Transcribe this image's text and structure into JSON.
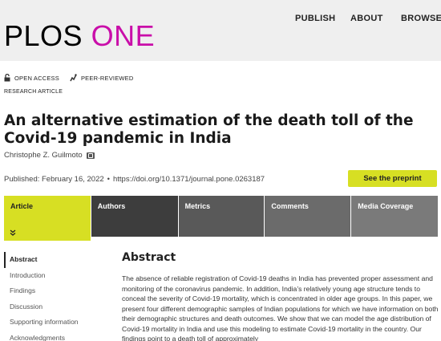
{
  "header": {
    "logo_part1": "PLOS",
    "logo_part2": "ONE",
    "nav": [
      "PUBLISH",
      "ABOUT",
      "BROWSE"
    ]
  },
  "badges": {
    "open_access": "OPEN ACCESS",
    "peer_reviewed": "PEER-REVIEWED"
  },
  "article_type": "RESEARCH ARTICLE",
  "title": "An alternative estimation of the death toll of the Covid-19 pandemic in India",
  "author": "Christophe Z. Guilmoto",
  "published": "Published: February 16, 2022",
  "doi": "https://doi.org/10.1371/journal.pone.0263187",
  "preprint_button": "See the preprint",
  "tabs": [
    "Article",
    "Authors",
    "Metrics",
    "Comments",
    "Media Coverage"
  ],
  "sidenav": [
    "Abstract",
    "Introduction",
    "Findings",
    "Discussion",
    "Supporting information",
    "Acknowledgments"
  ],
  "abstract": {
    "heading": "Abstract",
    "text": "The absence of reliable registration of Covid-19 deaths in India has prevented proper assessment and monitoring of the coronavirus pandemic. In addition, India’s relatively young age structure tends to conceal the severity of Covid-19 mortality, which is concentrated in older age groups. In this paper, we present four different demographic samples of Indian populations for which we have information on both their demographic structures and death outcomes. We show that we can model the age distribution of Covid-19 mortality in India and use this modeling to estimate Covid-19 mortality in the country. Our findings point to a death toll of approximately"
  },
  "colors": {
    "brand_magenta": "#c90ea9",
    "accent_lime": "#d7df23",
    "tab_dark": "#3d3d3d"
  }
}
